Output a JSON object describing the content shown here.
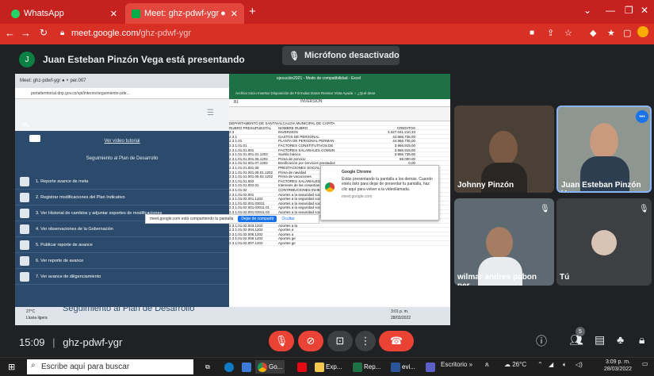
{
  "browser": {
    "tabs": [
      {
        "label": "WhatsApp"
      },
      {
        "label": "Meet: ghz-pdwf-ygr"
      }
    ],
    "new_tab": "+",
    "address_host": "meet.google.com/",
    "address_path": "ghz-pdwf-ygr"
  },
  "meet": {
    "presenter_initial": "J",
    "presenting_text": "Juan Esteban Pinzón Vega está presentando",
    "mic_status": "Micrófono desactivado",
    "meeting_time": "15:09",
    "meeting_code": "ghz-pdwf-ygr",
    "separator": "|"
  },
  "shared_screen": {
    "inner_tabs": "Meet: ghz-pdwf-ygr   ●   ×     per.007",
    "inner_address": "portalterritorial.dnp.gov.co/spt/interno/seguimiento-pde...",
    "video_link": "Ver vídeo tutorial",
    "section_title": "Seguimiento al Plan de Desarrollo",
    "menu_items": [
      "1. Reporte avance de meta",
      "2. Registrar modificaciones del Plan Indicativo",
      "3. Ver Historial de cambios y adjuntar soportes de modificaciones",
      "4. Ver observaciones de la Gobernación",
      "5. Publicar reporte de avance",
      "6. Ver reporte de avance",
      "7. Ver avance de diligenciamiento"
    ],
    "banner_text": "Seguimiento al Plan de Desarrollo",
    "share_notice": "meet.google.com está compartiendo tu pantalla",
    "share_stop": "Dejar de compartir",
    "share_hide": "Ocultar",
    "sheet_title": "ejecución2021 - Modo de compatibilidad - Excel",
    "sheet_menu": "Archivo  Inicio  Insertar  Disposición de  Fórmulas  Datos  Revisar  Vista  Ayuda  ♀ ¿Qué dese",
    "formula_cell": "B1",
    "formula_value": "INVERSION",
    "sheet_rows": [
      [
        "DEPARTAMENTO DE SANTANDER",
        "ALCALDIA MUNICIPAL DE CAPITA",
        ""
      ],
      [
        "RUBRO PRESUPUESTAL",
        "NOMBRE RUBRO",
        "CREDITOS"
      ],
      [
        "2.3",
        "INVERSION",
        "1.327.041.210,33"
      ],
      [
        "2.3.1",
        "GASTOS DE PERSONAL",
        "44.966.735,00"
      ],
      [
        "2.3.1.01",
        "PLANTA DE PERSONAL PERMAN",
        "44.966.735,00"
      ],
      [
        "2.3.1.01.01",
        "FACTORES CONSTITUTIVOS DE",
        "3.966.915,00"
      ],
      [
        "2.3.1.01.01.001",
        "FACTORES SALARIALES COMUN",
        "3.966.915,00"
      ],
      [
        "2.3.1.01.01.001.01.1202",
        "Sueldo básico",
        "3.966.735,00"
      ],
      [
        "2.3.1.01.01.001.06.1202",
        "Prima de servicio",
        "69.000,00"
      ],
      [
        "2.3.1.01.01.001.07.1202",
        "Bonificación por servicios prestados",
        "0,00"
      ],
      [
        "2.3.1.01.01.001.08",
        "PRESTACIONES SOCIALES",
        "0,00"
      ],
      [
        "2.3.1.01.01.001.08.01.1202",
        "Prima de navidad",
        "0,00"
      ],
      [
        "2.3.1.01.01.001.08.02.1202",
        "Prima de vacaciones",
        "0,00"
      ],
      [
        "2.3.1.01.01.002",
        "FACTORES SALARIALES ESPEC",
        "0,00"
      ],
      [
        "2.3.1.01.01.002.01",
        "Intereses de las cesantías",
        "0,00"
      ],
      [
        "2.3.1.01.02",
        "CONTRIBUCIONES INHERENTES",
        "41.303.715,00"
      ],
      [
        "2.3.1.01.02.001",
        "Aportes a la seguridad social en pe",
        "15.906.215,00"
      ],
      [
        "2.3.1.01.02.001.1202",
        "Aportes a la seguridad social en pe",
        "0,00"
      ],
      [
        "2.3.1.01.02.001.03011",
        "Aportes a la seguridad social en pe",
        "39.965.215,00"
      ],
      [
        "2.3.1.01.02.001.03011.01",
        "Aportes a la seguridad social en pe",
        "5.463.926,00"
      ],
      [
        "2.3.1.01.02.001.03011.02",
        "Aportes a la seguridad social en pe",
        "34.445.965,00"
      ],
      [
        "2.3.1.01.02.001.03011.03",
        "Aportes a la seguridad social en pe",
        "0,00"
      ],
      [
        "2.3.1.01.02.002.1202",
        "Aportes a la",
        ""
      ],
      [
        "2.3.1.01.02.003.1202",
        "Aportes a la",
        ""
      ],
      [
        "2.3.1.01.02.004.1202",
        "Aportes a",
        ""
      ],
      [
        "2.3.1.01.02.005.1202",
        "Aportes a",
        ""
      ],
      [
        "2.3.1.01.02.006.1202",
        "Aportes ge",
        ""
      ],
      [
        "2.3.1.01.02.007.1202",
        "Aportes ge",
        ""
      ]
    ],
    "toast_title": "Google Chrome",
    "toast_body": "Estás presentando tu pantalla a los demás. Cuando estés listo para dejar de presentar tu pantalla, haz clic aquí para volver a la videollamada.",
    "toast_footer": "meet.google.com",
    "mini_weather": "27°C",
    "mini_weather_desc": "Lluvia ligera",
    "mini_clock": "3:01 p. m.",
    "mini_date": "28/03/2022"
  },
  "participants": [
    {
      "name": "Johnny Pinzón"
    },
    {
      "name": "Juan Esteban Pinzón Vega"
    },
    {
      "name": "wilmar andres pabon per..."
    },
    {
      "name": "Tú"
    }
  ],
  "more_badge": "•••",
  "people_count": "5",
  "windows": {
    "search_placeholder": "Escribe aquí para buscar",
    "apps": [
      "Go...",
      "Exp...",
      "Rep...",
      "evi..."
    ],
    "desktop_label": "Escritorio",
    "tray_overflow": "»",
    "temperature": "26°C",
    "clock": "3:09 p. m.",
    "date": "28/03/2022"
  },
  "colors": {
    "chrome_red": "#c5221f",
    "meet_bg": "#202124",
    "control_red": "#ea4335",
    "excel_green": "#1e7145",
    "portal_blue": "#2c4a6b"
  }
}
